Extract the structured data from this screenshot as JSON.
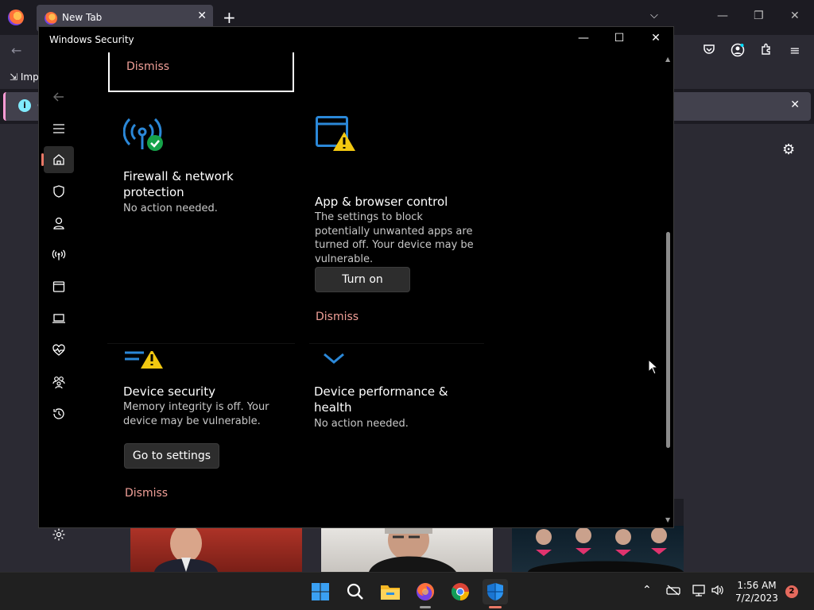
{
  "browser": {
    "tab_title": "New Tab",
    "import_label": "Imp",
    "info_label": "c"
  },
  "window": {
    "title": "Windows Security",
    "minimize_label": "—",
    "maximize_label": "☐",
    "close_label": "✕"
  },
  "nav": {
    "items": [
      {
        "name": "back",
        "icon": "back-arrow-icon"
      },
      {
        "name": "menu",
        "icon": "hamburger-icon"
      },
      {
        "name": "home",
        "icon": "home-icon"
      },
      {
        "name": "virus-protection",
        "icon": "shield-icon"
      },
      {
        "name": "account-protection",
        "icon": "person-icon"
      },
      {
        "name": "firewall",
        "icon": "wireless-icon"
      },
      {
        "name": "app-browser-control",
        "icon": "browser-window-icon"
      },
      {
        "name": "device-security",
        "icon": "laptop-icon"
      },
      {
        "name": "device-performance",
        "icon": "heart-pulse-icon"
      },
      {
        "name": "family-options",
        "icon": "family-icon"
      },
      {
        "name": "protection-history",
        "icon": "history-icon"
      },
      {
        "name": "settings",
        "icon": "gear-icon"
      }
    ]
  },
  "tiles": {
    "top_dismiss": "Dismiss",
    "firewall": {
      "title": "Firewall & network protection",
      "desc": "No action needed."
    },
    "app_browser": {
      "title": "App & browser control",
      "desc": "The settings to block potentially unwanted apps are turned off. Your device may be vulnerable.",
      "button": "Turn on",
      "dismiss": "Dismiss"
    },
    "device_security": {
      "title": "Device security",
      "desc": "Memory integrity is off. Your device may be vulnerable.",
      "button": "Go to settings",
      "dismiss": "Dismiss"
    },
    "device_performance": {
      "title": "Device performance & health",
      "desc": "No action needed."
    }
  },
  "colors": {
    "accent": "#e87866",
    "dismiss_link": "#f1a098",
    "icon_blue": "#2b88d8",
    "warning_yellow": "#f2c811",
    "ok_green": "#16a34a"
  },
  "taskbar": {
    "apps": [
      "start-icon",
      "search-icon",
      "file-explorer-icon",
      "firefox-icon",
      "chrome-icon",
      "windows-security-icon"
    ],
    "time": "1:56 AM",
    "date": "7/2/2023",
    "notification_count": "2"
  }
}
